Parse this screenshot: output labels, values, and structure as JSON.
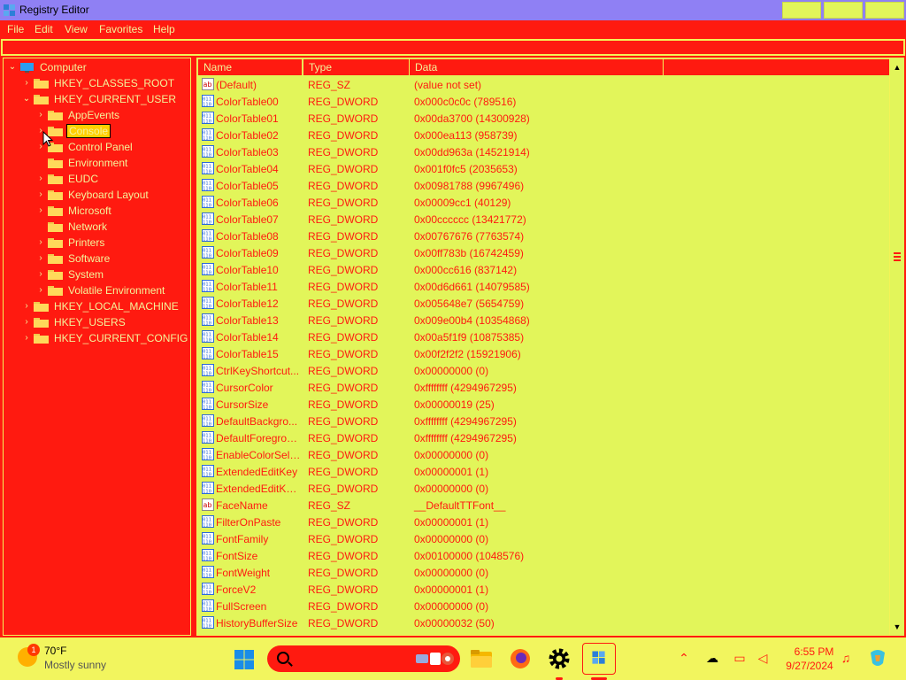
{
  "window": {
    "title": "Registry Editor"
  },
  "menu": [
    "File",
    "Edit",
    "View",
    "Favorites",
    "Help"
  ],
  "address": "",
  "tree": [
    {
      "label": "Computer",
      "level": 0,
      "expanded": true,
      "icon": "computer-icon"
    },
    {
      "label": "HKEY_CLASSES_ROOT",
      "level": 1,
      "expanded": false
    },
    {
      "label": "HKEY_CURRENT_USER",
      "level": 1,
      "expanded": true
    },
    {
      "label": "AppEvents",
      "level": 2,
      "expanded": false
    },
    {
      "label": "Console",
      "level": 2,
      "expanded": false,
      "selected": true
    },
    {
      "label": "Control Panel",
      "level": 2,
      "expanded": false
    },
    {
      "label": "Environment",
      "level": 2,
      "leaf": true
    },
    {
      "label": "EUDC",
      "level": 2,
      "expanded": false
    },
    {
      "label": "Keyboard Layout",
      "level": 2,
      "expanded": false
    },
    {
      "label": "Microsoft",
      "level": 2,
      "expanded": false
    },
    {
      "label": "Network",
      "level": 2,
      "leaf": true
    },
    {
      "label": "Printers",
      "level": 2,
      "expanded": false
    },
    {
      "label": "Software",
      "level": 2,
      "expanded": false
    },
    {
      "label": "System",
      "level": 2,
      "expanded": false
    },
    {
      "label": "Volatile Environment",
      "level": 2,
      "expanded": false
    },
    {
      "label": "HKEY_LOCAL_MACHINE",
      "level": 1,
      "expanded": false
    },
    {
      "label": "HKEY_USERS",
      "level": 1,
      "expanded": false
    },
    {
      "label": "HKEY_CURRENT_CONFIG",
      "level": 1,
      "expanded": false
    }
  ],
  "columns": {
    "name": "Name",
    "type": "Type",
    "data": "Data"
  },
  "values": [
    {
      "icon": "string-value-icon",
      "name": "(Default)",
      "type": "REG_SZ",
      "data": "(value not set)"
    },
    {
      "icon": "dword-value-icon",
      "name": "ColorTable00",
      "type": "REG_DWORD",
      "data": "0x000c0c0c (789516)"
    },
    {
      "icon": "dword-value-icon",
      "name": "ColorTable01",
      "type": "REG_DWORD",
      "data": "0x00da3700 (14300928)"
    },
    {
      "icon": "dword-value-icon",
      "name": "ColorTable02",
      "type": "REG_DWORD",
      "data": "0x000ea113 (958739)"
    },
    {
      "icon": "dword-value-icon",
      "name": "ColorTable03",
      "type": "REG_DWORD",
      "data": "0x00dd963a (14521914)"
    },
    {
      "icon": "dword-value-icon",
      "name": "ColorTable04",
      "type": "REG_DWORD",
      "data": "0x001f0fc5 (2035653)"
    },
    {
      "icon": "dword-value-icon",
      "name": "ColorTable05",
      "type": "REG_DWORD",
      "data": "0x00981788 (9967496)"
    },
    {
      "icon": "dword-value-icon",
      "name": "ColorTable06",
      "type": "REG_DWORD",
      "data": "0x00009cc1 (40129)"
    },
    {
      "icon": "dword-value-icon",
      "name": "ColorTable07",
      "type": "REG_DWORD",
      "data": "0x00cccccc (13421772)"
    },
    {
      "icon": "dword-value-icon",
      "name": "ColorTable08",
      "type": "REG_DWORD",
      "data": "0x00767676 (7763574)"
    },
    {
      "icon": "dword-value-icon",
      "name": "ColorTable09",
      "type": "REG_DWORD",
      "data": "0x00ff783b (16742459)"
    },
    {
      "icon": "dword-value-icon",
      "name": "ColorTable10",
      "type": "REG_DWORD",
      "data": "0x000cc616 (837142)"
    },
    {
      "icon": "dword-value-icon",
      "name": "ColorTable11",
      "type": "REG_DWORD",
      "data": "0x00d6d661 (14079585)"
    },
    {
      "icon": "dword-value-icon",
      "name": "ColorTable12",
      "type": "REG_DWORD",
      "data": "0x005648e7 (5654759)"
    },
    {
      "icon": "dword-value-icon",
      "name": "ColorTable13",
      "type": "REG_DWORD",
      "data": "0x009e00b4 (10354868)"
    },
    {
      "icon": "dword-value-icon",
      "name": "ColorTable14",
      "type": "REG_DWORD",
      "data": "0x00a5f1f9 (10875385)"
    },
    {
      "icon": "dword-value-icon",
      "name": "ColorTable15",
      "type": "REG_DWORD",
      "data": "0x00f2f2f2 (15921906)"
    },
    {
      "icon": "dword-value-icon",
      "name": "CtrlKeyShortcut...",
      "type": "REG_DWORD",
      "data": "0x00000000 (0)"
    },
    {
      "icon": "dword-value-icon",
      "name": "CursorColor",
      "type": "REG_DWORD",
      "data": "0xffffffff (4294967295)"
    },
    {
      "icon": "dword-value-icon",
      "name": "CursorSize",
      "type": "REG_DWORD",
      "data": "0x00000019 (25)"
    },
    {
      "icon": "dword-value-icon",
      "name": "DefaultBackgro...",
      "type": "REG_DWORD",
      "data": "0xffffffff (4294967295)"
    },
    {
      "icon": "dword-value-icon",
      "name": "DefaultForegrou...",
      "type": "REG_DWORD",
      "data": "0xffffffff (4294967295)"
    },
    {
      "icon": "dword-value-icon",
      "name": "EnableColorSele...",
      "type": "REG_DWORD",
      "data": "0x00000000 (0)"
    },
    {
      "icon": "dword-value-icon",
      "name": "ExtendedEditKey",
      "type": "REG_DWORD",
      "data": "0x00000001 (1)"
    },
    {
      "icon": "dword-value-icon",
      "name": "ExtendedEditKey...",
      "type": "REG_DWORD",
      "data": "0x00000000 (0)"
    },
    {
      "icon": "string-value-icon",
      "name": "FaceName",
      "type": "REG_SZ",
      "data": "__DefaultTTFont__"
    },
    {
      "icon": "dword-value-icon",
      "name": "FilterOnPaste",
      "type": "REG_DWORD",
      "data": "0x00000001 (1)"
    },
    {
      "icon": "dword-value-icon",
      "name": "FontFamily",
      "type": "REG_DWORD",
      "data": "0x00000000 (0)"
    },
    {
      "icon": "dword-value-icon",
      "name": "FontSize",
      "type": "REG_DWORD",
      "data": "0x00100000 (1048576)"
    },
    {
      "icon": "dword-value-icon",
      "name": "FontWeight",
      "type": "REG_DWORD",
      "data": "0x00000000 (0)"
    },
    {
      "icon": "dword-value-icon",
      "name": "ForceV2",
      "type": "REG_DWORD",
      "data": "0x00000001 (1)"
    },
    {
      "icon": "dword-value-icon",
      "name": "FullScreen",
      "type": "REG_DWORD",
      "data": "0x00000000 (0)"
    },
    {
      "icon": "dword-value-icon",
      "name": "HistoryBufferSize",
      "type": "REG_DWORD",
      "data": "0x00000032 (50)"
    }
  ],
  "taskbar": {
    "weather": {
      "temp": "70°F",
      "condition": "Mostly sunny",
      "badge": "1"
    },
    "search_placeholder": "",
    "apps": [
      "start-icon",
      "file-explorer-icon",
      "firefox-icon",
      "settings-icon",
      "registry-editor-icon"
    ],
    "tray": [
      "chevron-up-icon",
      "network-off-icon",
      "display-icon",
      "volume-muted-icon",
      "notifications-icon"
    ],
    "time": "6:55 PM",
    "date": "9/27/2024"
  },
  "colors": {
    "window_bg": "#ff1a10",
    "pane_bg": "#e2f55a",
    "text_light": "#f3f39a",
    "title_bg": "#8f80f4",
    "taskbar_bg": "#f2f55e"
  }
}
